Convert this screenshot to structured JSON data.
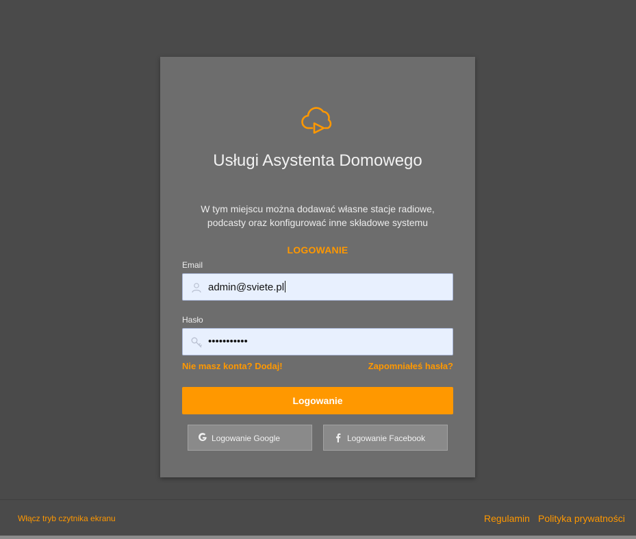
{
  "app": {
    "title": "Usługi Asystenta Domowego",
    "description": "W tym miejscu można dodawać własne stacje radiowe, podcasty oraz konfigurować inne składowe systemu",
    "logo_icon": "cloud-play-icon"
  },
  "login": {
    "section_title": "LOGOWANIE",
    "email_label": "Email",
    "email_value": "admin@sviete.pl",
    "password_label": "Hasło",
    "password_value": "•••••••••••",
    "register_link": "Nie masz konta? Dodaj!",
    "forgot_link": "Zapomniałeś hasła?",
    "submit_label": "Logowanie",
    "google_label": "Logowanie Google",
    "facebook_label": "Logowanie Facebook"
  },
  "footer": {
    "reader_mode": "Włącz tryb czytnika ekranu",
    "terms": "Regulamin",
    "privacy": "Polityka prywatności"
  },
  "colors": {
    "accent": "#ff9800",
    "background": "#4a4a4a",
    "card": "#6d6d6d",
    "input_bg": "#e8f0fe"
  }
}
